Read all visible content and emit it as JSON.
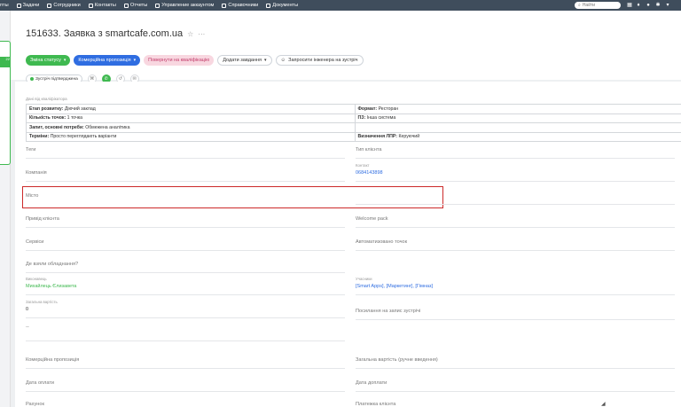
{
  "topbar": {
    "items": [
      {
        "icon": "dashboard-icon",
        "label": "пты"
      },
      {
        "icon": "tasks-icon",
        "label": "Задачи"
      },
      {
        "icon": "employees-icon",
        "label": "Сотрудники"
      },
      {
        "icon": "contacts-icon",
        "label": "Контакты"
      },
      {
        "icon": "reports-icon",
        "label": "Отчеты"
      },
      {
        "icon": "account-icon",
        "label": "Управление аккаунтом"
      },
      {
        "icon": "reference-icon",
        "label": "Справочники"
      },
      {
        "icon": "documents-icon",
        "label": "Документы"
      }
    ],
    "search_placeholder": "Найти"
  },
  "header": {
    "title": "151633. Заявка з smartcafe.com.ua",
    "buttons": {
      "change_status": "Зміна статусу",
      "commercial_offer": "Комерційна пропозиція",
      "return_qualification": "Повернути на кваліфікацію",
      "add_task": "Додати завдання",
      "invite_engineer": "Запросити інженера на зустріч"
    },
    "status_chip": "Зустріч підтверджена"
  },
  "qualification": {
    "caption": "Дані від кваліфікатора",
    "rows": [
      {
        "l_key": "Етап розвитку:",
        "l_val": "Діючий заклад",
        "r_key": "Формат:",
        "r_val": "Ресторан"
      },
      {
        "l_key": "Кількість точок:",
        "l_val": "1 точка",
        "r_key": "ПЗ:",
        "r_val": "Інша система"
      },
      {
        "l_key": "Запит, основні потреби:",
        "l_val": "Обмежена аналітика",
        "r_key": "",
        "r_val": ""
      },
      {
        "l_key": "Терміни:",
        "l_val": "Просто переглядають варіанти",
        "r_key": "Визначення ЛПР:",
        "r_val": "Керуючий"
      }
    ]
  },
  "fields": {
    "tags": "Теги",
    "client_type": "Тип клієнта",
    "company": "Компанія",
    "contact_cap": "Контакт",
    "contact_val": "0684143898",
    "city": "Місто",
    "client_source": "Привід клієнта",
    "welcome_pack": "Welcome pack",
    "services": "Сервіси",
    "automated_points": "Автоматизовано точок",
    "equipment": "Де взяли обладнання?",
    "executor_cap": "Виконавець",
    "executor_val": "Михайлець Єлизавета",
    "participants_cap": "Учасники",
    "participants_val": "[Smart Apps], [Маркетинг], [Гімназ]",
    "total_cost_cap": "Загальна вартість",
    "total_cost_val": "0",
    "meeting_link": "Посилання на запис зустрічі",
    "dash": "--",
    "commercial_offer": "Комерційна пропозиція",
    "total_cost_manual": "Загальна вартість (ручне введення)",
    "payment_date": "Дата оплати",
    "payment_date2": "Дата доплати",
    "invoice": "Рахунок",
    "payment_client": "Платежка клієнта"
  },
  "leftrail": {
    "badge": "22"
  }
}
